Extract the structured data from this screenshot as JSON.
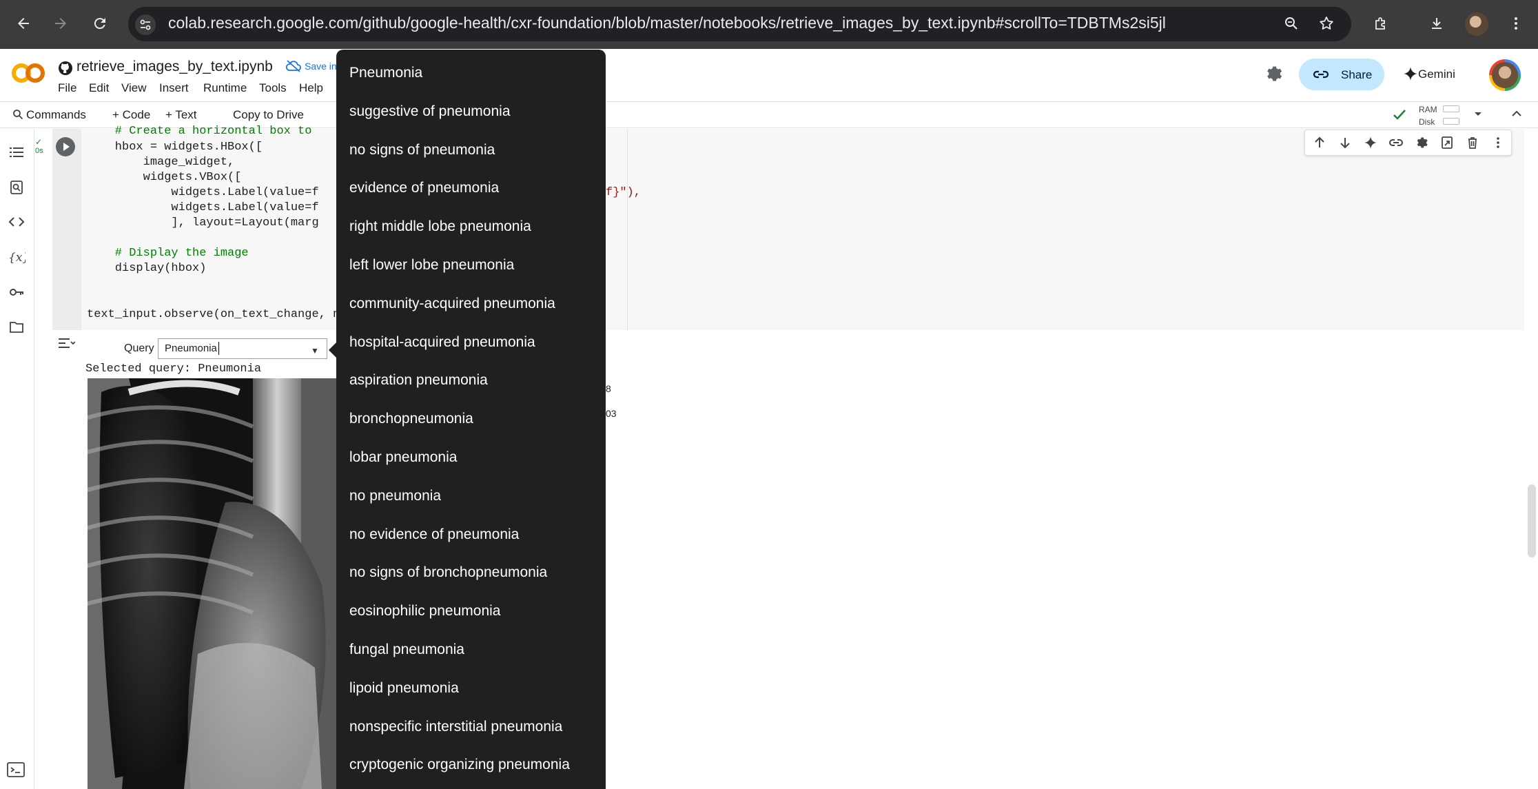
{
  "browser": {
    "url": "colab.research.google.com/github/google-health/cxr-foundation/blob/master/notebooks/retrieve_images_by_text.ipynb#scrollTo=TDBTMs2si5jl"
  },
  "colab": {
    "notebook_title": "retrieve_images_by_text.ipynb",
    "save_hint": "Save in",
    "menu": [
      "File",
      "Edit",
      "View",
      "Insert",
      "Runtime",
      "Tools",
      "Help"
    ],
    "share_label": "Share",
    "gemini_label": "Gemini"
  },
  "toolbar": {
    "commands": "Commands",
    "code": "+ Code",
    "text": "+ Text",
    "copy_to_drive": "Copy to Drive",
    "ram": "RAM",
    "disk": "Disk"
  },
  "cell": {
    "exec_time": "0s",
    "lines": [
      {
        "kind": "comment",
        "text": "    # Create a horizontal box to"
      },
      {
        "kind": "code",
        "text": "    hbox = widgets.HBox(["
      },
      {
        "kind": "code",
        "text": "        image_widget,"
      },
      {
        "kind": "code",
        "text": "        widgets.VBox(["
      },
      {
        "kind": "code",
        "text": "            widgets.Label(value=f"
      },
      {
        "kind": "code",
        "text": "            widgets.Label(value=f"
      },
      {
        "kind": "code",
        "text": "            ], layout=Layout(marg"
      },
      {
        "kind": "code",
        "text": ""
      },
      {
        "kind": "comment",
        "text": "    # Display the image"
      },
      {
        "kind": "code",
        "text": "    display(hbox)"
      },
      {
        "kind": "code",
        "text": ""
      },
      {
        "kind": "code",
        "text": ""
      },
      {
        "kind": "code",
        "text": "text_input.observe(on_text_change, na"
      }
    ],
    "peek_code_suffix": "f}\"),"
  },
  "output": {
    "query_label": "Query",
    "query_value": "Pneumonia",
    "selected_query": "Selected query: Pneumonia",
    "peek_values": [
      "8",
      "03"
    ]
  },
  "dropdown": {
    "options": [
      "Pneumonia",
      "suggestive of pneumonia",
      "no signs of pneumonia",
      "evidence of pneumonia",
      "right middle lobe pneumonia",
      "left lower lobe pneumonia",
      "community-acquired pneumonia",
      "hospital-acquired pneumonia",
      "aspiration pneumonia",
      "bronchopneumonia",
      "lobar pneumonia",
      "no pneumonia",
      "no evidence of pneumonia",
      "no signs of bronchopneumonia",
      "eosinophilic pneumonia",
      "fungal pneumonia",
      "lipoid pneumonia",
      "nonspecific interstitial pneumonia",
      "cryptogenic organizing pneumonia"
    ]
  }
}
